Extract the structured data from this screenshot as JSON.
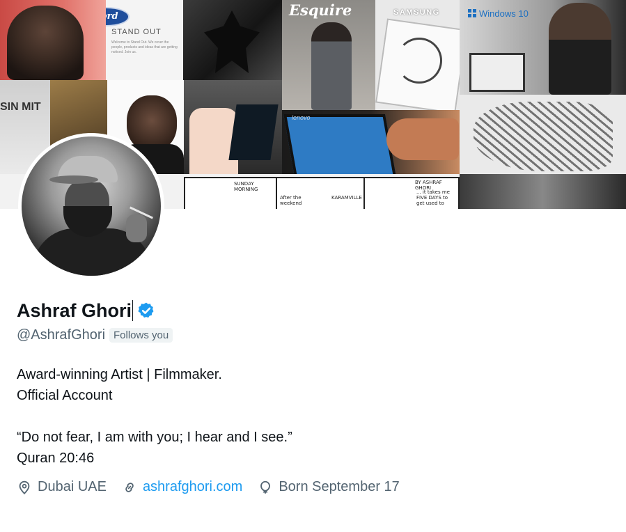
{
  "banner": {
    "ford_logo": "Ford",
    "ford_heading": "STAND OUT",
    "ford_body": "Welcome to Stand Out. We cover the people, products and ideas that are getting noticed. Join us.",
    "esquire_logo": "Esquire",
    "samsung_logo": "SAMSUNG",
    "windows_logo": "Windows 10",
    "lenovo_logo": "lenovo",
    "sign_text": "SIN MIT",
    "comic_panels": [
      "SUNDAY MORNING",
      "After the weekend ...",
      "KARAMVILLE",
      "BY ASHRAF GHORI",
      "... it takes me FIVE DAYS to get used to"
    ]
  },
  "profile": {
    "name": "Ashraf Ghori",
    "handle": "@AshrafGhori",
    "follows_badge": "Follows you",
    "bio": "Award-winning Artist | Filmmaker.\nOfficial Account\n\n“Do not fear, I am with you; I hear and I see.”\nQuran 20:46",
    "location": "Dubai UAE",
    "website": "ashrafghori.com",
    "birthday": "Born September 17"
  },
  "icons": {
    "verified": "verified-badge-icon",
    "location": "location-pin-icon",
    "link": "link-icon",
    "birthday": "balloon-icon"
  },
  "colors": {
    "accent": "#1d9bf0",
    "secondary_text": "#536471",
    "primary_text": "#0f1419"
  }
}
